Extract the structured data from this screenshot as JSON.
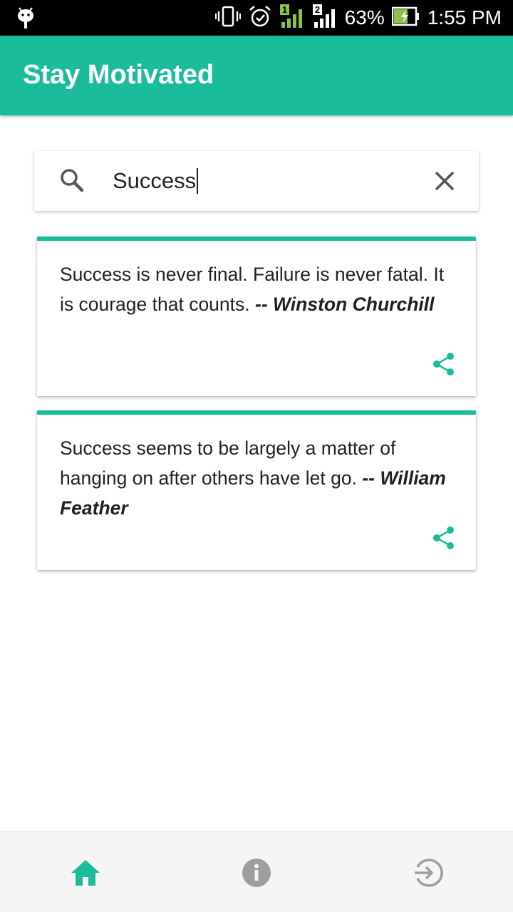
{
  "status_bar": {
    "battery": "63%",
    "time": "1:55 PM",
    "sim1_label": "1",
    "sim2_label": "2",
    "icons": [
      "android-icon",
      "vibrate-icon",
      "alarm-icon",
      "signal-sim1-icon",
      "signal-sim2-icon",
      "battery-charging-icon"
    ]
  },
  "app_bar": {
    "title": "Stay Motivated"
  },
  "search": {
    "value": "Success",
    "icon": "search-icon",
    "clear_icon": "close-icon"
  },
  "quotes": [
    {
      "text": "Success is never final. Failure is never fatal. It is courage that counts.",
      "author": "-- Winston Churchill",
      "share_icon": "share-icon"
    },
    {
      "text": "Success seems to be largely a matter of hanging on after others have let go.",
      "author": "-- William Feather",
      "share_icon": "share-icon"
    }
  ],
  "bottom_nav": {
    "items": [
      {
        "icon": "home-icon",
        "active": true
      },
      {
        "icon": "info-icon",
        "active": false
      },
      {
        "icon": "logout-icon",
        "active": false
      }
    ]
  },
  "colors": {
    "accent": "#1abc9c",
    "inactive_icon": "#9e9e9e",
    "text": "#212121"
  }
}
